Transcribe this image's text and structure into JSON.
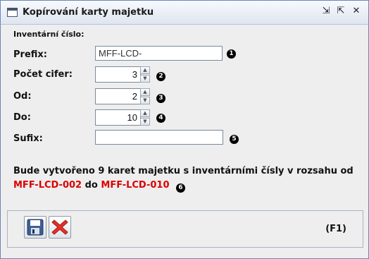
{
  "window": {
    "title": "Kopírování karty majetku",
    "buttons": {
      "minimize": "⇲",
      "restore": "⇱",
      "close": "✕"
    }
  },
  "form": {
    "section_label": "Inventární číslo:",
    "prefix": {
      "label": "Prefix:",
      "value": "MFF-LCD-",
      "badge": "1"
    },
    "digits": {
      "label": "Počet cifer:",
      "value": "3",
      "badge": "2"
    },
    "from": {
      "label": "Od:",
      "value": "2",
      "badge": "3"
    },
    "to": {
      "label": "Do:",
      "value": "10",
      "badge": "4"
    },
    "suffix": {
      "label": "Sufix:",
      "value": "",
      "badge": "5"
    }
  },
  "message": {
    "line1": "Bude vytvořeno 9 karet majetku s inventárními čísly v rozsahu od",
    "start": "MFF-LCD-002",
    "middle": "do",
    "end": "MFF-LCD-010",
    "badge": "6"
  },
  "footer": {
    "save_icon": "floppy-disk-icon",
    "cancel_icon": "red-x-icon",
    "help_hint": "(F1)"
  },
  "colors": {
    "accent": "#dd0000",
    "frame": "#6a86b8"
  }
}
